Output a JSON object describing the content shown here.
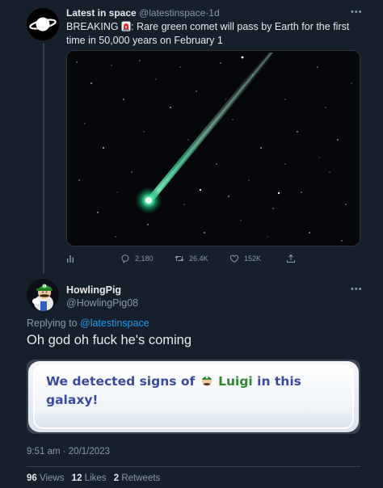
{
  "tweet": {
    "name": "Latest in space",
    "handle": "@latestinspace",
    "separator": "·",
    "age": "1d",
    "text_before_emoji": "BREAKING ",
    "emoji": "rotating-light-emoji",
    "text_after_emoji": ": Rare green comet will pass by Earth for the first time in 50,000 years on February 1",
    "image": "green-comet-photo",
    "actions": {
      "replies": "2,180",
      "retweets": "26.4K",
      "likes": "152K"
    }
  },
  "reply": {
    "name": "HowlingPig",
    "handle": "@HowlingPig08",
    "replying_prefix": "Replying to ",
    "replying_to": "@latestinspace",
    "text": "Oh god oh fuck he's coming",
    "image_text": {
      "part1": "We detected signs of",
      "luigi": "Luigi",
      "part2": "in this",
      "part3": "galaxy!"
    },
    "timestamp": "9:51 am · 20/1/2023",
    "stats": {
      "views_count": "96",
      "views_label": "Views",
      "likes_count": "12",
      "likes_label": "Likes",
      "retweets_count": "2",
      "retweets_label": "Retweets"
    }
  },
  "colors": {
    "background": "#15202b",
    "text": "#e7e9ea",
    "muted": "#8b98a5",
    "link": "#1d9bf0",
    "comet": "#3fe8a0"
  }
}
